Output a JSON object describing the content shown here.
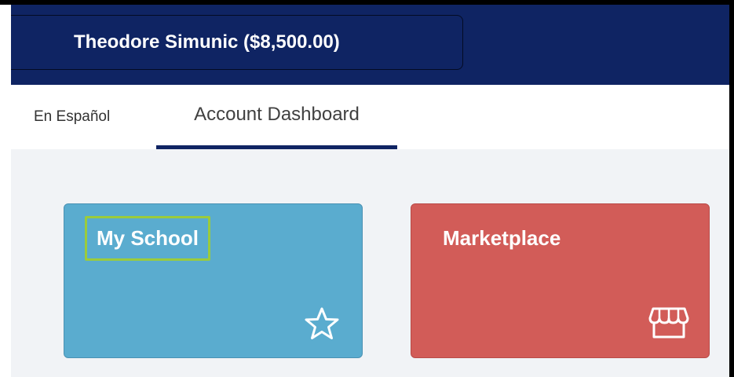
{
  "header": {
    "account_label": "Theodore Simunic ($8,500.00)",
    "background": "#0f2463"
  },
  "tabs": {
    "spanish_label": "En Español",
    "dashboard_label": "Account Dashboard",
    "active_tab": "Account Dashboard"
  },
  "cards": [
    {
      "title": "My School",
      "icon": "star-icon",
      "color": "#5aaccf"
    },
    {
      "title": "Marketplace",
      "icon": "storefront-icon",
      "color": "#d25c58"
    }
  ]
}
